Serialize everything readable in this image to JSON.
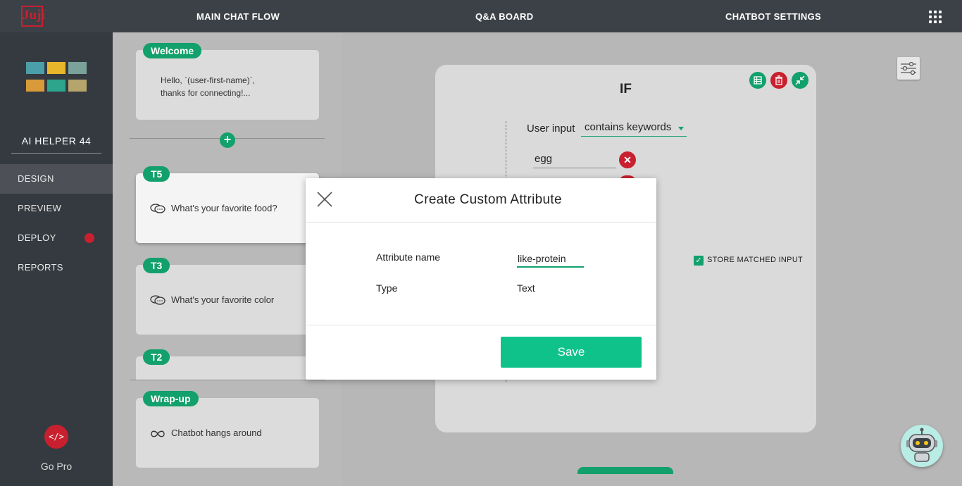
{
  "app": {
    "logo_text": "Juji",
    "nav": [
      {
        "label": "MAIN CHAT FLOW"
      },
      {
        "label": "Q&A BOARD"
      },
      {
        "label": "CHATBOT SETTINGS"
      }
    ]
  },
  "sidebar": {
    "bot_name": "AI HELPER 44",
    "items": [
      {
        "label": "DESIGN"
      },
      {
        "label": "PREVIEW"
      },
      {
        "label": "DEPLOY"
      },
      {
        "label": "REPORTS"
      }
    ],
    "gopro_icon": "</>",
    "gopro_label": "Go Pro"
  },
  "flow": {
    "cards": [
      {
        "tag": "Welcome",
        "text_line1": "Hello, `(user-first-name)`,",
        "text_line2": "thanks for connecting!..."
      },
      {
        "tag": "T5",
        "text": "What's your favorite food?"
      },
      {
        "tag": "T3",
        "text": "What's your favorite color"
      },
      {
        "tag": "T2",
        "text": ""
      },
      {
        "tag": "Wrap-up",
        "text": "Chatbot hangs around"
      }
    ],
    "add_symbol": "+"
  },
  "editor": {
    "title": "IF",
    "condition_label": "User input",
    "condition_operator": "contains keywords",
    "keywords": [
      "egg"
    ],
    "store_label": "STORE MATCHED INPUT",
    "store_checked": true
  },
  "modal": {
    "title": "Create Custom Attribute",
    "attribute_name_label": "Attribute name",
    "attribute_name_value": "like-protein",
    "type_label": "Type",
    "type_value": "Text",
    "save_label": "Save"
  },
  "colors": {
    "accent_green": "#12a06c",
    "save_green": "#0fc289",
    "danger_red": "#c8202f",
    "topbar": "#3c4147",
    "sidebar": "#353a40"
  }
}
